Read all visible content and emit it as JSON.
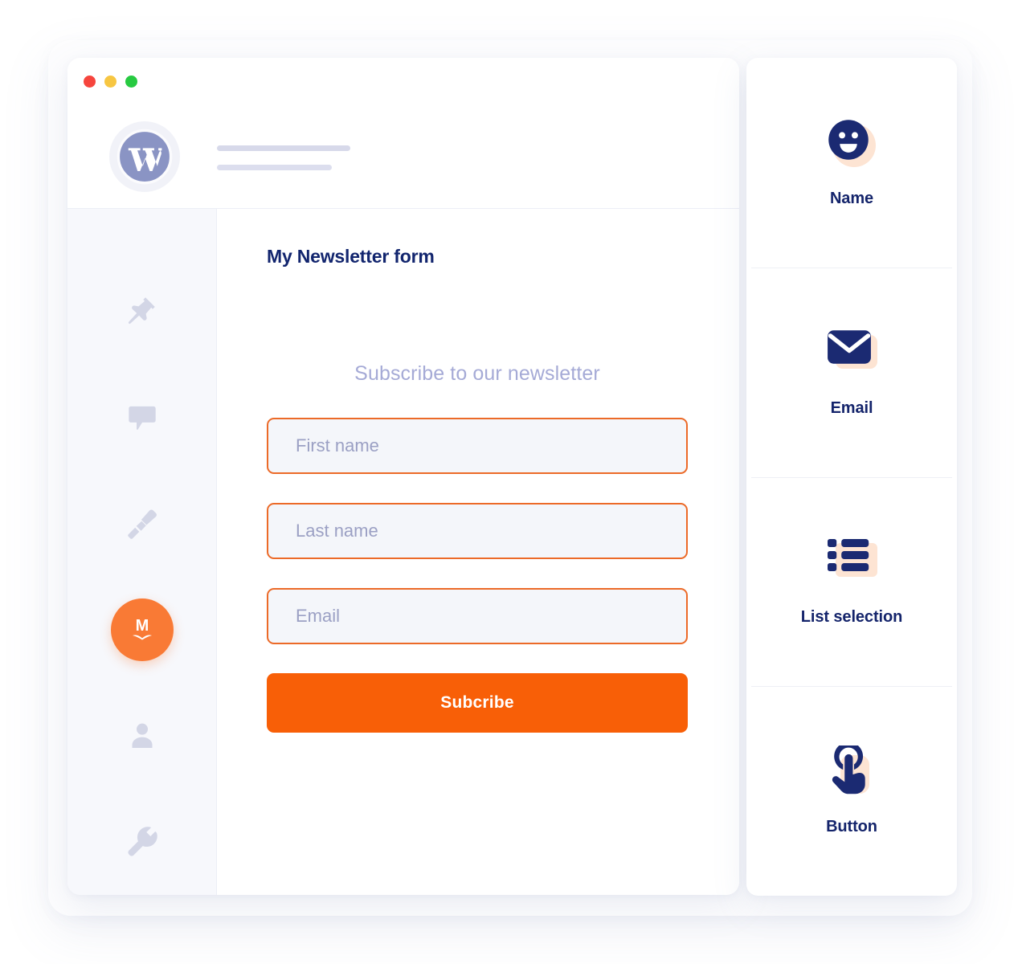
{
  "window": {
    "traffic_lights": [
      {
        "name": "close",
        "color": "#f6453d"
      },
      {
        "name": "minimize",
        "color": "#f7c642"
      },
      {
        "name": "maximize",
        "color": "#27ca41"
      }
    ]
  },
  "header": {
    "logo_icon": "wordpress-icon",
    "placeholder_lines": 2
  },
  "sidebar": {
    "items": [
      {
        "icon": "pin-icon",
        "name": "pin",
        "active": false
      },
      {
        "icon": "comment-icon",
        "name": "comments",
        "active": false
      },
      {
        "icon": "paintbrush-icon",
        "name": "appearance",
        "active": false
      },
      {
        "icon": "mailpoet-logo",
        "name": "mailpoet",
        "active": true,
        "letter": "M"
      },
      {
        "icon": "user-icon",
        "name": "users",
        "active": false
      },
      {
        "icon": "wrench-icon",
        "name": "tools",
        "active": false
      }
    ],
    "active_color": "#f97a35"
  },
  "editor": {
    "title": "My Newsletter form",
    "form_heading": "Subscribe to our newsletter",
    "fields": [
      {
        "placeholder": "First name",
        "name": "first-name"
      },
      {
        "placeholder": "Last name",
        "name": "last-name"
      },
      {
        "placeholder": "Email",
        "name": "email"
      }
    ],
    "submit_label": "Subcribe",
    "accent_border": "#ec6a28",
    "button_color": "#f85f07",
    "title_color": "#12256e",
    "heading_color": "#a5aad6",
    "placeholder_color": "#9ba0c4"
  },
  "blocks_panel": {
    "items": [
      {
        "label": "Name",
        "icon": "smiley-face-icon"
      },
      {
        "label": "Email",
        "icon": "envelope-icon"
      },
      {
        "label": "List selection",
        "icon": "list-icon"
      },
      {
        "label": "Button",
        "icon": "tap-hand-icon"
      }
    ],
    "icon_color": "#1b2a72",
    "shadow_color": "#fde4d3",
    "label_color": "#14246b"
  }
}
